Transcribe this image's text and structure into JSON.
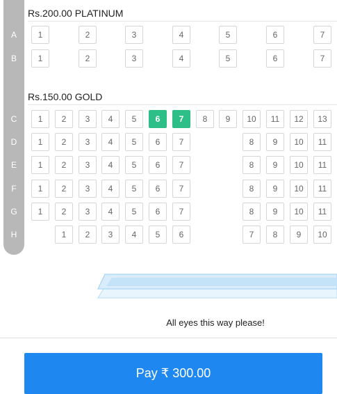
{
  "sections": [
    {
      "title": "Rs.200.00 PLATINUM",
      "rows": [
        {
          "letter": "A",
          "seats": [
            {
              "num": "1",
              "col": 0
            },
            {
              "num": "2",
              "col": 2
            },
            {
              "num": "3",
              "col": 4
            },
            {
              "num": "4",
              "col": 6
            },
            {
              "num": "5",
              "col": 8
            },
            {
              "num": "6",
              "col": 10
            },
            {
              "num": "7",
              "col": 12
            }
          ]
        },
        {
          "letter": "B",
          "seats": [
            {
              "num": "1",
              "col": 0
            },
            {
              "num": "2",
              "col": 2
            },
            {
              "num": "3",
              "col": 4
            },
            {
              "num": "4",
              "col": 6
            },
            {
              "num": "5",
              "col": 8
            },
            {
              "num": "6",
              "col": 10
            },
            {
              "num": "7",
              "col": 12
            }
          ]
        }
      ]
    },
    {
      "title": "Rs.150.00 GOLD",
      "rows": [
        {
          "letter": "C",
          "seats": [
            {
              "num": "1",
              "col": 0
            },
            {
              "num": "2",
              "col": 1
            },
            {
              "num": "3",
              "col": 2
            },
            {
              "num": "4",
              "col": 3
            },
            {
              "num": "5",
              "col": 4
            },
            {
              "num": "6",
              "col": 5,
              "selected": true
            },
            {
              "num": "7",
              "col": 6,
              "selected": true
            },
            {
              "num": "8",
              "col": 7
            },
            {
              "num": "9",
              "col": 8
            },
            {
              "num": "10",
              "col": 9
            },
            {
              "num": "11",
              "col": 10
            },
            {
              "num": "12",
              "col": 11
            },
            {
              "num": "13",
              "col": 12
            }
          ]
        },
        {
          "letter": "D",
          "seats": [
            {
              "num": "1",
              "col": 0
            },
            {
              "num": "2",
              "col": 1
            },
            {
              "num": "3",
              "col": 2
            },
            {
              "num": "4",
              "col": 3
            },
            {
              "num": "5",
              "col": 4
            },
            {
              "num": "6",
              "col": 5
            },
            {
              "num": "7",
              "col": 6
            },
            {
              "num": "8",
              "col": 9
            },
            {
              "num": "9",
              "col": 10
            },
            {
              "num": "10",
              "col": 11
            },
            {
              "num": "11",
              "col": 12
            }
          ]
        },
        {
          "letter": "E",
          "seats": [
            {
              "num": "1",
              "col": 0
            },
            {
              "num": "2",
              "col": 1
            },
            {
              "num": "3",
              "col": 2
            },
            {
              "num": "4",
              "col": 3
            },
            {
              "num": "5",
              "col": 4
            },
            {
              "num": "6",
              "col": 5
            },
            {
              "num": "7",
              "col": 6
            },
            {
              "num": "8",
              "col": 9
            },
            {
              "num": "9",
              "col": 10
            },
            {
              "num": "10",
              "col": 11
            },
            {
              "num": "11",
              "col": 12
            }
          ]
        },
        {
          "letter": "F",
          "seats": [
            {
              "num": "1",
              "col": 0
            },
            {
              "num": "2",
              "col": 1
            },
            {
              "num": "3",
              "col": 2
            },
            {
              "num": "4",
              "col": 3
            },
            {
              "num": "5",
              "col": 4
            },
            {
              "num": "6",
              "col": 5
            },
            {
              "num": "7",
              "col": 6
            },
            {
              "num": "8",
              "col": 9
            },
            {
              "num": "9",
              "col": 10
            },
            {
              "num": "10",
              "col": 11
            },
            {
              "num": "11",
              "col": 12
            }
          ]
        },
        {
          "letter": "G",
          "seats": [
            {
              "num": "1",
              "col": 0
            },
            {
              "num": "2",
              "col": 1
            },
            {
              "num": "3",
              "col": 2
            },
            {
              "num": "4",
              "col": 3
            },
            {
              "num": "5",
              "col": 4
            },
            {
              "num": "6",
              "col": 5
            },
            {
              "num": "7",
              "col": 6
            },
            {
              "num": "8",
              "col": 9
            },
            {
              "num": "9",
              "col": 10
            },
            {
              "num": "10",
              "col": 11
            },
            {
              "num": "11",
              "col": 12
            }
          ]
        },
        {
          "letter": "H",
          "seats": [
            {
              "num": "1",
              "col": 1
            },
            {
              "num": "2",
              "col": 2
            },
            {
              "num": "3",
              "col": 3
            },
            {
              "num": "4",
              "col": 4
            },
            {
              "num": "5",
              "col": 5
            },
            {
              "num": "6",
              "col": 6
            },
            {
              "num": "7",
              "col": 9
            },
            {
              "num": "8",
              "col": 10
            },
            {
              "num": "9",
              "col": 11
            },
            {
              "num": "10",
              "col": 12
            }
          ]
        }
      ]
    }
  ],
  "screen": {
    "caption": "All eyes this way please!"
  },
  "footer": {
    "pay_label": "Pay ₹ 300.00"
  },
  "colors": {
    "selected_seat": "#2dbf87",
    "pay_button": "#1e88f0",
    "row_rail": "#b8b8b8",
    "seat_border": "#d6d6d6",
    "screen_fill": "#d8ecfb",
    "screen_outline": "#a8d4f5"
  }
}
